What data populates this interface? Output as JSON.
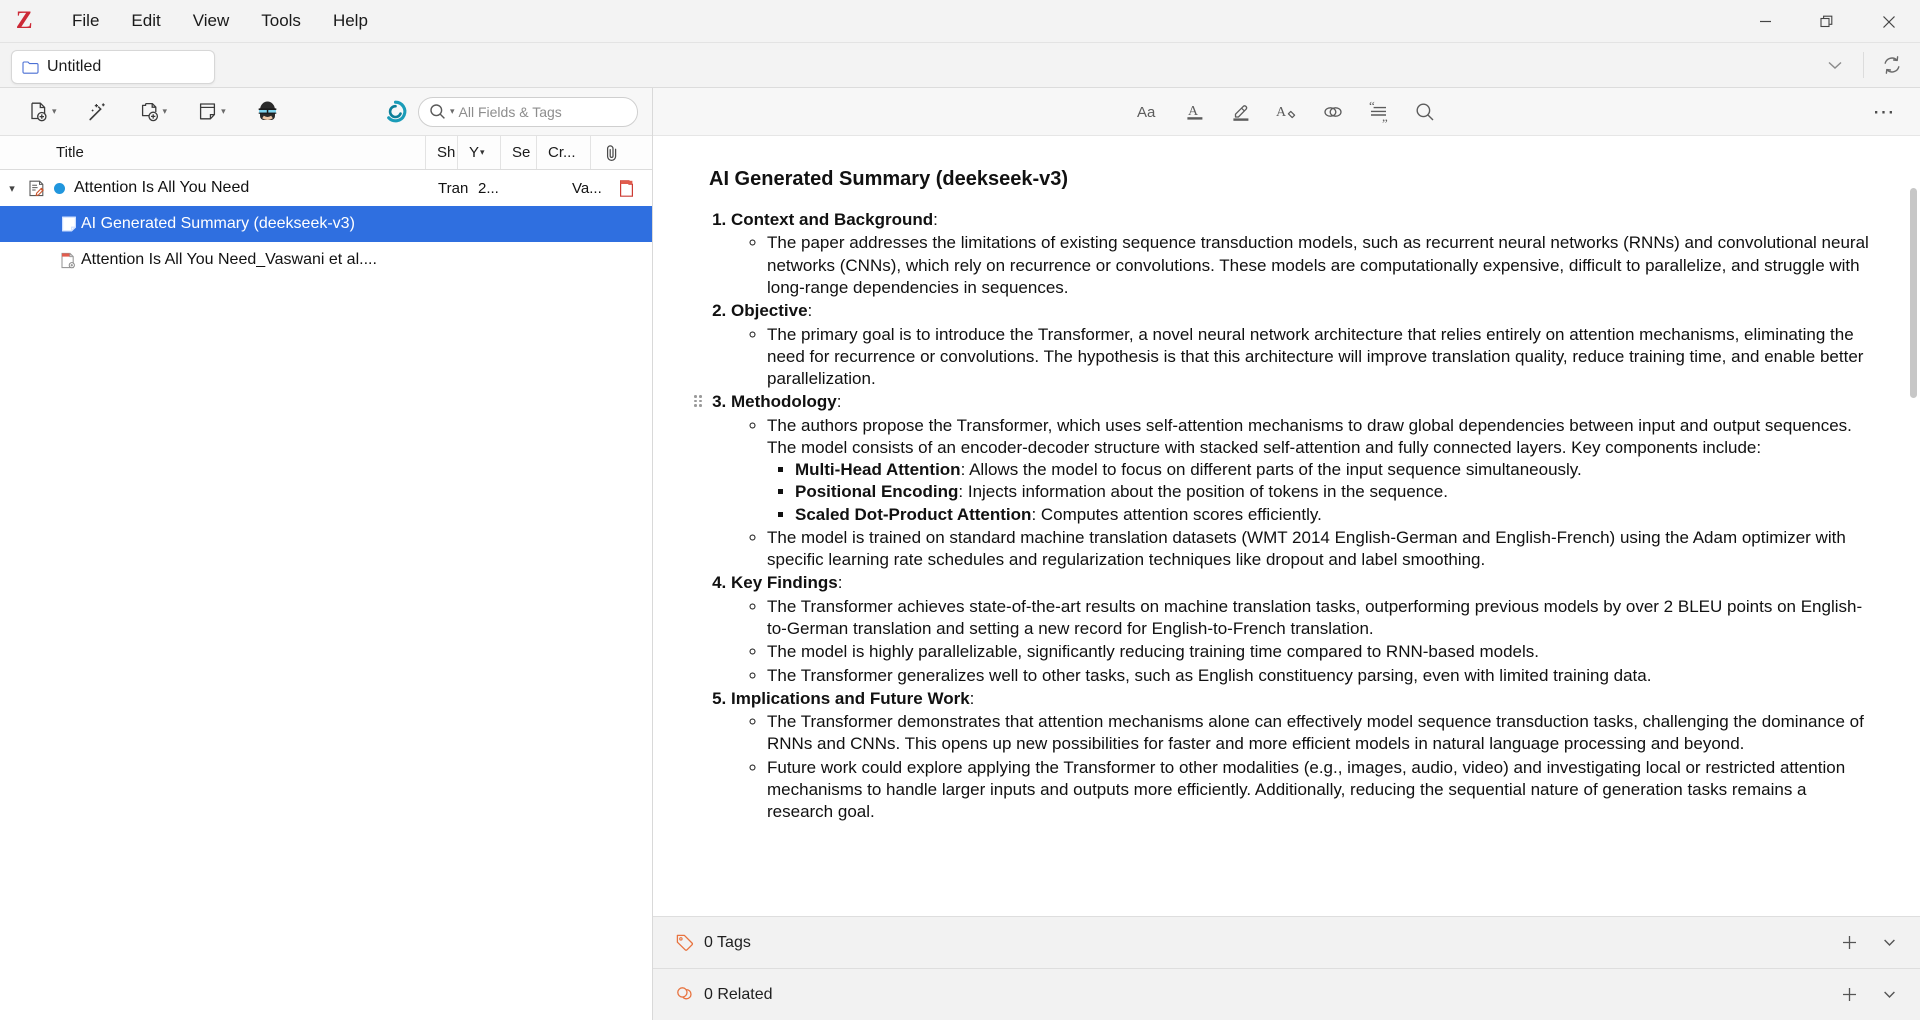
{
  "app": {
    "logo": "Z",
    "menus": [
      "File",
      "Edit",
      "View",
      "Tools",
      "Help"
    ],
    "window_controls": [
      "minimize",
      "restore",
      "close"
    ]
  },
  "tabbar": {
    "tab_label": "Untitled",
    "tab_icon": "folder-icon",
    "dropdown_icon": "chevron-down-icon",
    "sync_icon": "sync-icon"
  },
  "item_toolbar": {
    "buttons": [
      {
        "name": "new-item-button",
        "icon": "new-document-icon",
        "has_caret": true
      },
      {
        "name": "add-by-identifier-button",
        "icon": "magic-wand-icon",
        "has_caret": false
      },
      {
        "name": "add-attachment-button",
        "icon": "add-attachment-icon",
        "has_caret": true
      },
      {
        "name": "new-note-button",
        "icon": "note-icon",
        "has_caret": true
      },
      {
        "name": "ai-assistant-button",
        "icon": "glasses-avatar-icon",
        "has_caret": false
      }
    ],
    "sync_status_icon": "sync-circle-icon",
    "search": {
      "icon": "search-icon",
      "caret": "chevron-down-icon",
      "placeholder": "All Fields & Tags",
      "value": ""
    }
  },
  "columns": [
    {
      "key": "title",
      "label": "Title",
      "sorted": false
    },
    {
      "key": "short",
      "label": "Sh",
      "sorted": false
    },
    {
      "key": "year",
      "label": "Y",
      "sorted": true
    },
    {
      "key": "series",
      "label": "Se",
      "sorted": false
    },
    {
      "key": "creator",
      "label": "Cr...",
      "sorted": false
    },
    {
      "key": "attach",
      "label": "",
      "icon": "paperclip-icon",
      "sorted": false
    }
  ],
  "items": [
    {
      "name": "item-row-attention",
      "title": "Attention Is All You Need",
      "icon": "journal-article-icon",
      "tag_dot_color": "#2196dd",
      "short": "Tran",
      "year": "2...",
      "series": "",
      "creator": "Va...",
      "attachment_icon": "pdf-icon",
      "expanded": true,
      "level": 0,
      "selected": false
    },
    {
      "name": "item-row-ai-summary",
      "title": "AI Generated Summary (deekseek-v3)",
      "icon": "note-icon",
      "short": "",
      "year": "",
      "series": "",
      "creator": "",
      "attachment_icon": "",
      "level": 1,
      "selected": true
    },
    {
      "name": "item-row-pdf-attachment",
      "title": "Attention Is All You Need_Vaswani et al....",
      "icon": "pdf-attachment-icon",
      "short": "",
      "year": "",
      "series": "",
      "creator": "",
      "attachment_icon": "",
      "level": 1,
      "selected": false
    }
  ],
  "editor_toolbar": {
    "buttons": [
      {
        "name": "format-text-button",
        "icon": "format-aa-icon",
        "label": "Aa"
      },
      {
        "name": "text-color-button",
        "icon": "text-color-a-icon"
      },
      {
        "name": "highlight-button",
        "icon": "highlighter-icon"
      },
      {
        "name": "clear-formatting-button",
        "icon": "clear-format-a-icon"
      },
      {
        "name": "insert-link-button",
        "icon": "link-icon"
      },
      {
        "name": "insert-citation-button",
        "icon": "citation-quote-icon"
      },
      {
        "name": "find-in-note-button",
        "icon": "search-icon"
      }
    ],
    "options_label": "⋯",
    "options_icon": "more-options-icon"
  },
  "note": {
    "heading": "AI Generated Summary (deekseek-v3)",
    "sections": [
      {
        "number": "1.",
        "title": "Context and Background",
        "colon": ":",
        "bullets": [
          {
            "text": "The paper addresses the limitations of existing sequence transduction models, such as recurrent neural networks (RNNs) and convolutional neural networks (CNNs), which rely on recurrence or convolutions. These models are computationally expensive, difficult to parallelize, and struggle with long-range dependencies in sequences.",
            "subbullets": []
          }
        ]
      },
      {
        "number": "2.",
        "title": "Objective",
        "colon": ":",
        "bullets": [
          {
            "text": "The primary goal is to introduce the Transformer, a novel neural network architecture that relies entirely on attention mechanisms, eliminating the need for recurrence or convolutions. The hypothesis is that this architecture will improve translation quality, reduce training time, and enable better parallelization.",
            "subbullets": []
          }
        ]
      },
      {
        "number": "3.",
        "title": "Methodology",
        "colon": ":",
        "bullets": [
          {
            "text": "The authors propose the Transformer, which uses self-attention mechanisms to draw global dependencies between input and output sequences. The model consists of an encoder-decoder structure with stacked self-attention and fully connected layers. Key components include:",
            "subbullets": [
              {
                "bold": "Multi-Head Attention",
                "rest": ": Allows the model to focus on different parts of the input sequence simultaneously."
              },
              {
                "bold": "Positional Encoding",
                "rest": ": Injects information about the position of tokens in the sequence."
              },
              {
                "bold": "Scaled Dot-Product Attention",
                "rest": ": Computes attention scores efficiently."
              }
            ]
          },
          {
            "text": "The model is trained on standard machine translation datasets (WMT 2014 English-German and English-French) using the Adam optimizer with specific learning rate schedules and regularization techniques like dropout and label smoothing.",
            "subbullets": []
          }
        ]
      },
      {
        "number": "4.",
        "title": "Key Findings",
        "colon": ":",
        "bullets": [
          {
            "text": "The Transformer achieves state-of-the-art results on machine translation tasks, outperforming previous models by over 2 BLEU points on English-to-German translation and setting a new record for English-to-French translation.",
            "subbullets": []
          },
          {
            "text": "The model is highly parallelizable, significantly reducing training time compared to RNN-based models.",
            "subbullets": []
          },
          {
            "text": "The Transformer generalizes well to other tasks, such as English constituency parsing, even with limited training data.",
            "subbullets": []
          }
        ]
      },
      {
        "number": "5.",
        "title": "Implications and Future Work",
        "colon": ":",
        "bullets": [
          {
            "text": "The Transformer demonstrates that attention mechanisms alone can effectively model sequence transduction tasks, challenging the dominance of RNNs and CNNs. This opens up new possibilities for faster and more efficient models in natural language processing and beyond.",
            "subbullets": []
          },
          {
            "text": "Future work could explore applying the Transformer to other modalities (e.g., images, audio, video) and investigating local or restricted attention mechanisms to handle larger inputs and outputs more efficiently. Additionally, reducing the sequential nature of generation tasks remains a research goal.",
            "subbullets": []
          }
        ]
      }
    ]
  },
  "bottom_sections": [
    {
      "name": "tags-section",
      "label": "0 Tags",
      "icon": "tag-icon",
      "add_icon": "plus-icon",
      "collapse_icon": "chevron-down-icon",
      "accent": "#e8733f"
    },
    {
      "name": "related-section",
      "label": "0 Related",
      "icon": "related-icon",
      "add_icon": "plus-icon",
      "collapse_icon": "chevron-down-icon",
      "accent": "#e8733f"
    }
  ]
}
